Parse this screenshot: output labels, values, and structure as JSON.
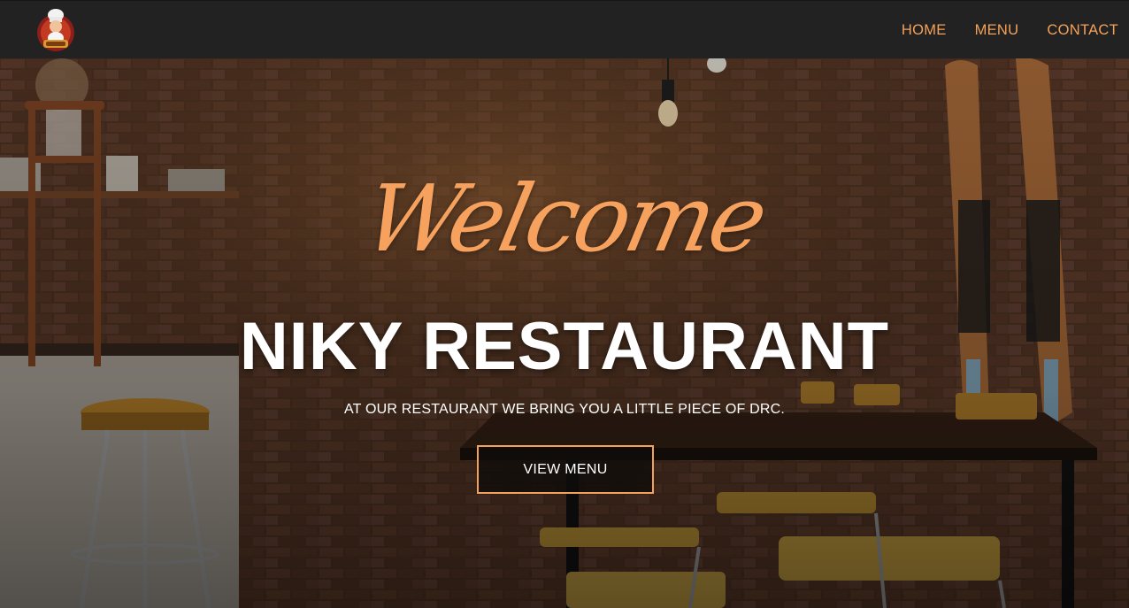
{
  "nav": {
    "logo_alt": "Tasty",
    "links": [
      {
        "label": "HOME"
      },
      {
        "label": "MENU"
      },
      {
        "label": "CONTACT"
      }
    ]
  },
  "hero": {
    "welcome": "Welcome",
    "title": "NIKY RESTAURANT",
    "subtitle": "AT OUR RESTAURANT WE BRING YOU A LITTLE PIECE OF DRC.",
    "cta_label": "VIEW MENU"
  },
  "colors": {
    "accent": "#f4a259",
    "navbar": "#222222",
    "text": "#ffffff"
  }
}
